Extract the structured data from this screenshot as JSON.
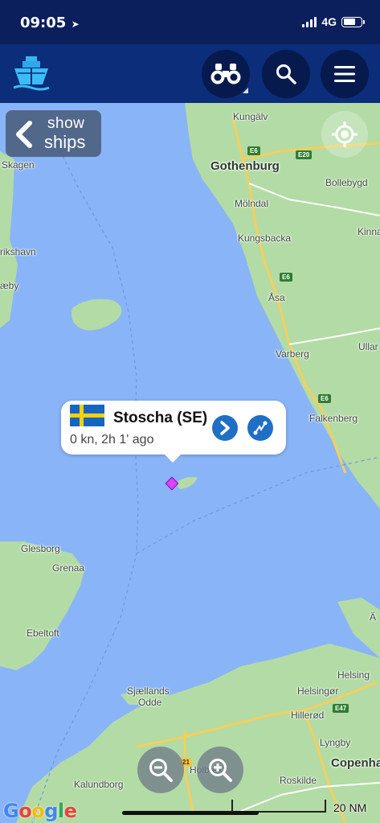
{
  "status_bar": {
    "time": "09:05",
    "network": "4G"
  },
  "app_bar": {
    "logo_icon": "ship-logo-icon",
    "buttons": [
      {
        "name": "binoculars",
        "icon": "binoculars-icon"
      },
      {
        "name": "search",
        "icon": "search-icon"
      },
      {
        "name": "menu",
        "icon": "hamburger-menu-icon"
      }
    ]
  },
  "map": {
    "show_ships": {
      "line1": "show",
      "line2": "ships"
    },
    "place_labels": {
      "kungalv": "Kungälv",
      "gothenburg": "Gothenburg",
      "bollebygd": "Bollebygd",
      "molndal": "Mölndal",
      "kungsbacka": "Kungsbacka",
      "kinna": "Kinna",
      "asa": "Åsa",
      "varberg": "Varberg",
      "ullare": "Ullar",
      "falkenberg": "Falkenberg",
      "skagen": "Skagen",
      "frederikshavn": "rikshavn",
      "saeby": "æby",
      "glesborg": "Glesborg",
      "grenaa": "Grenaa",
      "ebeltoft": "Ebeltoft",
      "sjaellands_odde_1": "Sjællands",
      "sjaellands_odde_2": "Odde",
      "helsing_e": "Helsing",
      "helsingor": "Helsingør",
      "hillerod": "Hillerød",
      "lyngby": "Lyngby",
      "copenhagen": "Copenhage",
      "roskilde": "Roskilde",
      "kalundborg": "Kalundborg",
      "holbaek": "Holbæk",
      "a_right": "Ä"
    },
    "road_shields": {
      "e6_top": "E6",
      "e20": "E20",
      "e6_mid": "E6",
      "e6_low": "E6",
      "e47": "E47",
      "r21": "21"
    },
    "ship_popup": {
      "vessel_name": "Stoscha (SE)",
      "flag_country": "Sweden",
      "status": "0 kn, 2h 1' ago",
      "colors": {
        "flag_blue": "#1565c0",
        "flag_yellow": "#ffd100",
        "button": "#1f6fc5"
      }
    },
    "ship_marker_color": "#e040fb",
    "attribution": "Google",
    "scale_label": "20 NM"
  }
}
